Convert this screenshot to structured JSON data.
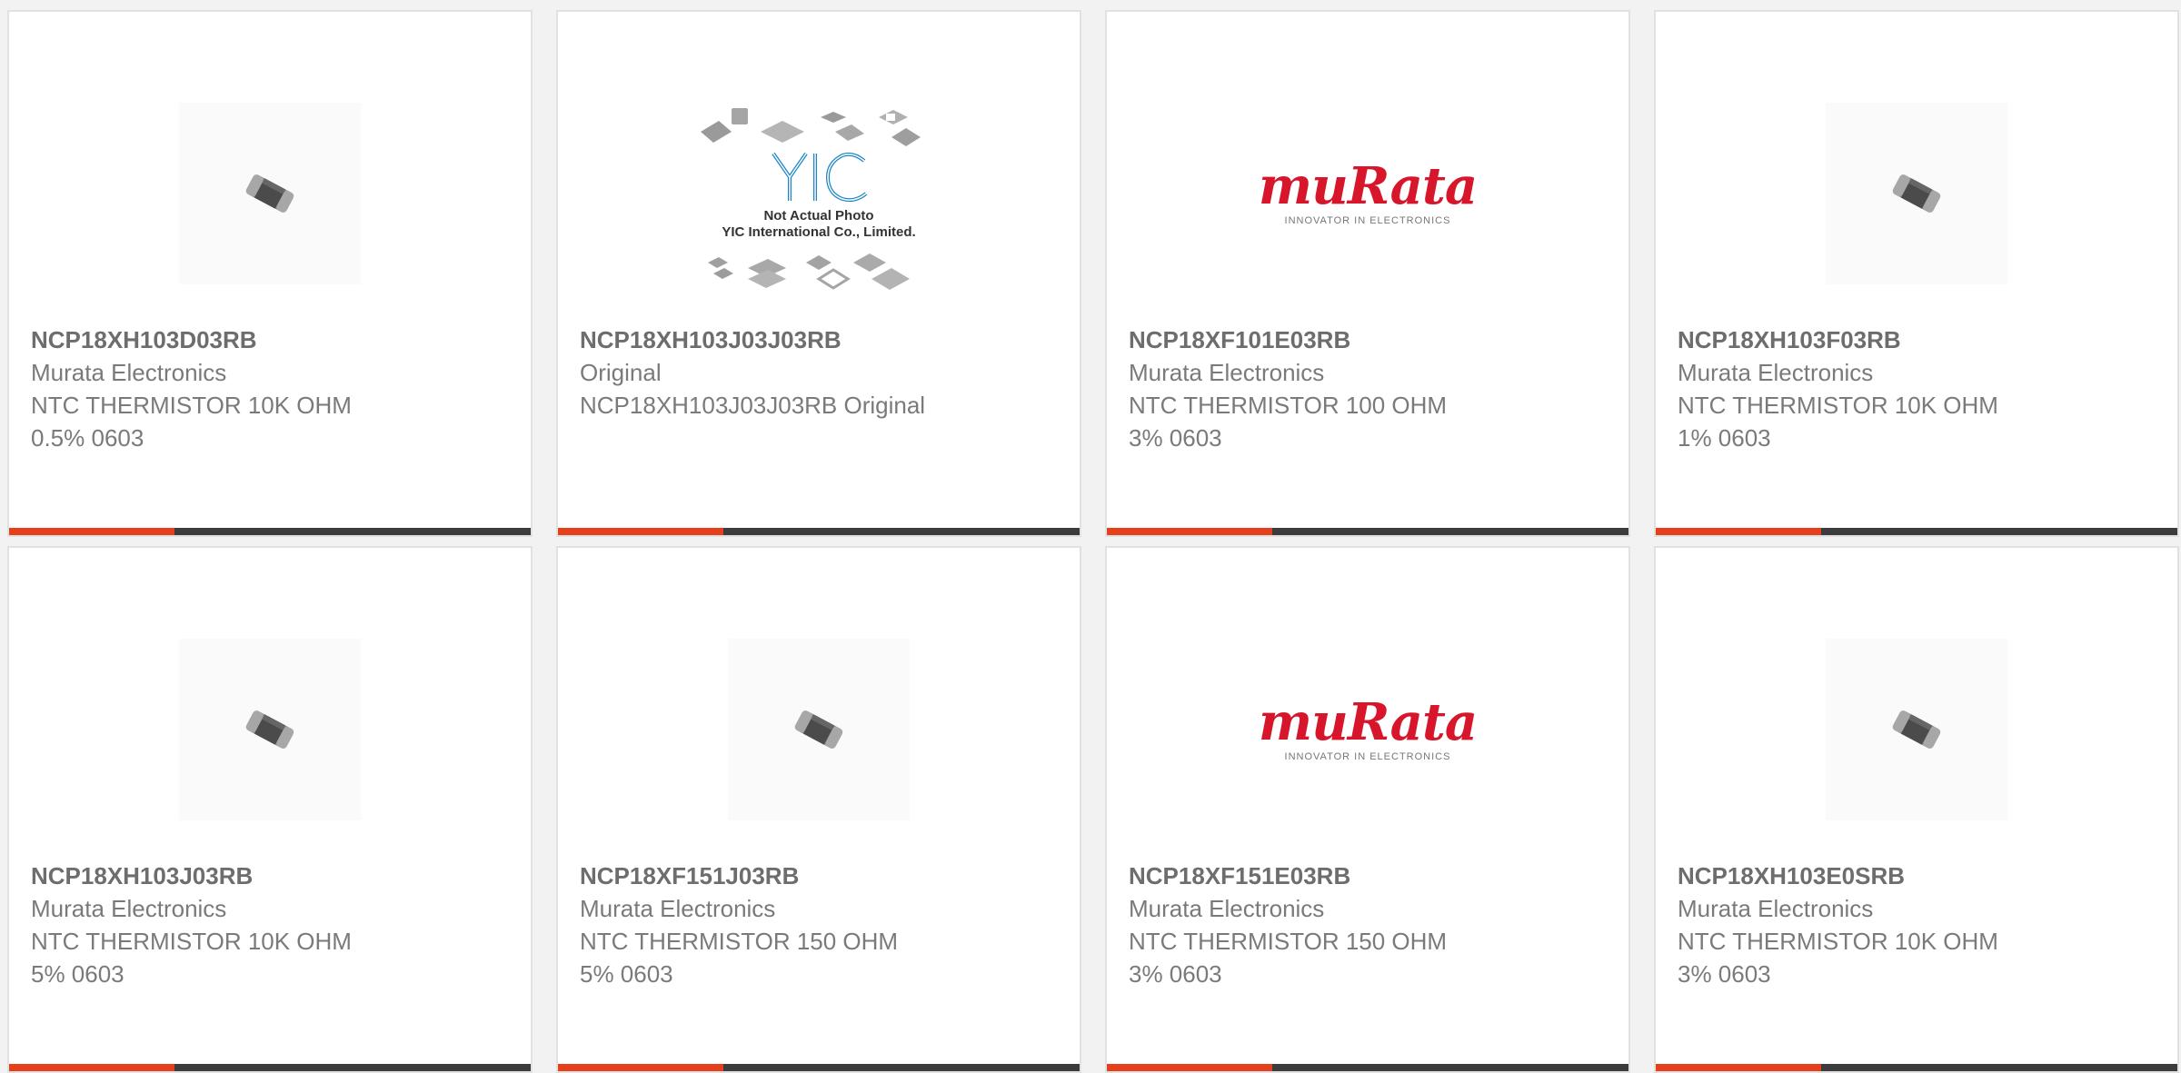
{
  "colors": {
    "accent": "#e5401b",
    "bar": "#3c3c3c",
    "murata_red": "#d7162c",
    "yic_blue": "#1a86c8"
  },
  "cards": [
    {
      "image": "chip-thermistor",
      "part_no": "NCP18XH103D03RB",
      "line1": "Murata Electronics",
      "line2": "NTC THERMISTOR 10K OHM",
      "line3": "0.5% 0603"
    },
    {
      "image": "yic-placeholder",
      "image_text": {
        "logo": "YIC",
        "line1": "Not Actual Photo",
        "line2": "YIC International Co., Limited."
      },
      "part_no": "NCP18XH103J03J03RB",
      "line1": "Original",
      "line2": "NCP18XH103J03J03RB Original",
      "line3": ""
    },
    {
      "image": "murata-logo",
      "image_text": {
        "logo": "muRata",
        "tagline": "INNOVATOR IN ELECTRONICS"
      },
      "part_no": "NCP18XF101E03RB",
      "line1": "Murata Electronics",
      "line2": "NTC THERMISTOR 100 OHM",
      "line3": "3% 0603"
    },
    {
      "image": "chip-thermistor",
      "part_no": "NCP18XH103F03RB",
      "line1": "Murata Electronics",
      "line2": "NTC THERMISTOR 10K OHM",
      "line3": "1% 0603"
    },
    {
      "image": "chip-thermistor",
      "part_no": "NCP18XH103J03RB",
      "line1": "Murata Electronics",
      "line2": "NTC THERMISTOR 10K OHM",
      "line3": "5% 0603"
    },
    {
      "image": "chip-thermistor",
      "part_no": "NCP18XF151J03RB",
      "line1": "Murata Electronics",
      "line2": "NTC THERMISTOR 150 OHM",
      "line3": "5% 0603"
    },
    {
      "image": "murata-logo",
      "image_text": {
        "logo": "muRata",
        "tagline": "INNOVATOR IN ELECTRONICS"
      },
      "part_no": "NCP18XF151E03RB",
      "line1": "Murata Electronics",
      "line2": "NTC THERMISTOR 150 OHM",
      "line3": "3% 0603"
    },
    {
      "image": "chip-thermistor",
      "part_no": "NCP18XH103E0SRB",
      "line1": "Murata Electronics",
      "line2": "NTC THERMISTOR 10K OHM",
      "line3": "3% 0603"
    }
  ]
}
